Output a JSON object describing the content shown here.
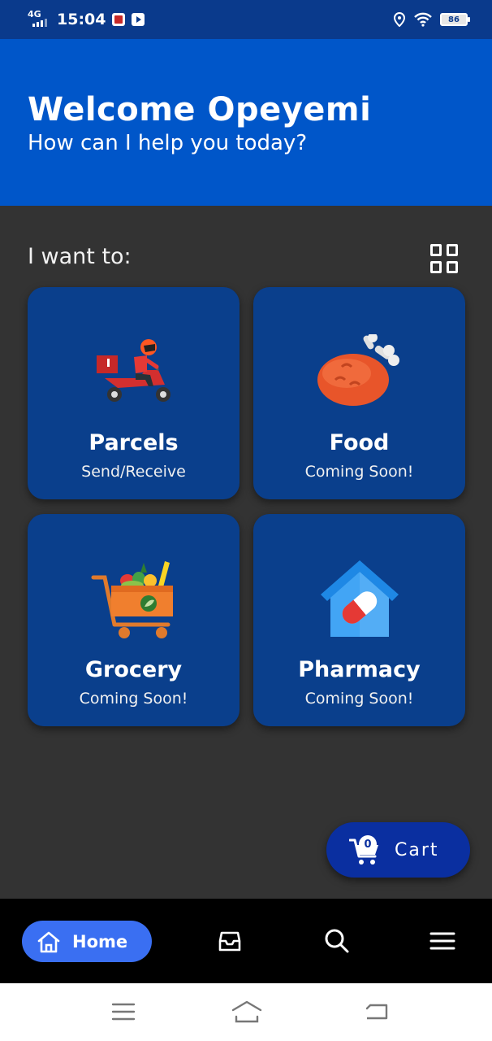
{
  "status_bar": {
    "network": "4G",
    "time": "15:04",
    "battery": "86",
    "icons": [
      "signal-icon",
      "message-icon",
      "youtube-icon",
      "location-icon",
      "wifi-icon",
      "battery-icon"
    ]
  },
  "header": {
    "welcome": "Welcome Opeyemi",
    "subtitle": "How can I help you today?"
  },
  "section": {
    "title": "I want to:"
  },
  "cards": [
    {
      "title": "Parcels",
      "subtitle": "Send/Receive",
      "icon": "scooter-delivery-icon"
    },
    {
      "title": "Food",
      "subtitle": "Coming Soon!",
      "icon": "chicken-drumstick-icon"
    },
    {
      "title": "Grocery",
      "subtitle": "Coming Soon!",
      "icon": "grocery-cart-icon"
    },
    {
      "title": "Pharmacy",
      "subtitle": "Coming Soon!",
      "icon": "pharmacy-house-icon"
    }
  ],
  "cart": {
    "label": "Cart",
    "count": "0"
  },
  "bottom_nav": {
    "home_label": "Home",
    "items": [
      "home-icon",
      "inbox-icon",
      "search-icon",
      "menu-icon"
    ]
  },
  "colors": {
    "status_bar": "#0a3a8c",
    "header": "#0056c9",
    "background": "#333333",
    "card": "#0a3f8c",
    "cart_fab": "#0a2fa0",
    "nav_active": "#3a6ff2"
  }
}
